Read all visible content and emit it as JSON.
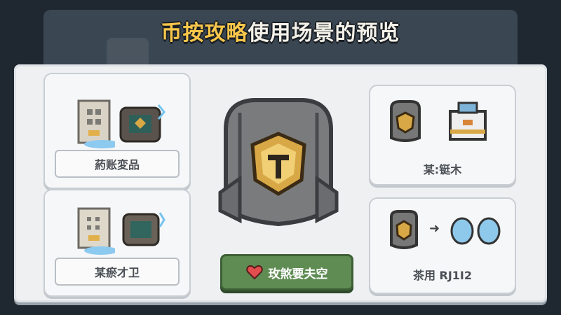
{
  "title": {
    "highlight": "币按攻略",
    "rest": "使用场景的预览"
  },
  "cards": {
    "top_left_label": "葯账変品",
    "bottom_left_label": "某瘀才卫",
    "top_right_label": "某:铤木",
    "bottom_right_label": "茶用 RJ1I2"
  },
  "action_button": {
    "label": "玫煞要夫空"
  },
  "icons": {
    "top_left": [
      "stone-tower-icon",
      "armor-chest-icon"
    ],
    "bottom_left": [
      "stone-tower-icon",
      "armor-chest-icon"
    ],
    "top_right": [
      "armor-shield-icon",
      "metal-box-icon"
    ],
    "bottom_right": [
      "armor-shield-icon",
      "arrow-right-icon",
      "egg-icon",
      "egg-icon"
    ],
    "center": "rock-armor-icon",
    "button": "heart-icon"
  },
  "colors": {
    "accent": "#f7c64a",
    "button": "#5f8c53",
    "emblem": "#d8a846"
  }
}
